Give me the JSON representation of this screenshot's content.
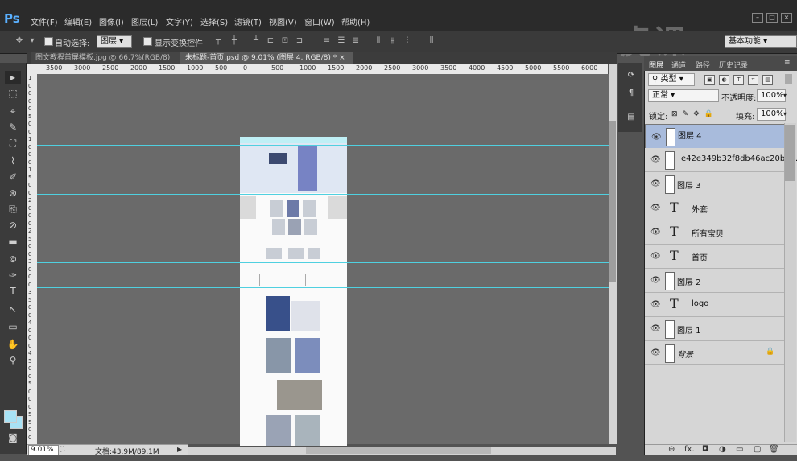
{
  "app": {
    "logo": "Ps"
  },
  "menu": [
    "文件(F)",
    "编辑(E)",
    "图像(I)",
    "图层(L)",
    "文字(Y)",
    "选择(S)",
    "滤镜(T)",
    "视图(V)",
    "窗口(W)",
    "帮助(H)"
  ],
  "watermark": "虎课",
  "options": {
    "auto_select_label": "自动选择:",
    "auto_select_value": "图层",
    "show_transform_label": "显示变换控件",
    "workspace": "基本功能"
  },
  "tabs": [
    {
      "label": "图文教程首屏模板.jpg @ 66.7%(RGB/8)",
      "close": "×"
    },
    {
      "label": "未标题-首页.psd @ 9.01% (图层 4, RGB/8) *",
      "close": "×"
    }
  ],
  "ruler_h": [
    "3500",
    "3000",
    "2500",
    "2000",
    "1500",
    "1000",
    "500",
    "0",
    "500",
    "1000",
    "1500",
    "2000",
    "2500",
    "3000",
    "3500",
    "4000",
    "4500",
    "5000",
    "5500",
    "6000",
    "6500"
  ],
  "ruler_v": [
    "1",
    "0",
    "0",
    "0",
    "0",
    "5",
    "0",
    "0",
    "1",
    "0",
    "0",
    "0",
    "1",
    "5",
    "0",
    "0",
    "2",
    "0",
    "0",
    "0",
    "2",
    "5",
    "0",
    "0",
    "3",
    "0",
    "0",
    "0",
    "3",
    "5",
    "0",
    "0",
    "4",
    "0",
    "0",
    "0",
    "4",
    "5",
    "0",
    "0",
    "5",
    "0",
    "0",
    "0",
    "5",
    "5",
    "0",
    "0"
  ],
  "status": {
    "zoom": "9.01%",
    "doc": "文档:43.9M/89.1M"
  },
  "panel": {
    "tabs": [
      "图层",
      "通道",
      "路径",
      "历史记录"
    ],
    "filter_kind": "类型",
    "blend_mode": "正常",
    "opacity_label": "不透明度:",
    "opacity_value": "100%",
    "lock_label": "锁定:",
    "fill_label": "填充:",
    "fill_value": "100%"
  },
  "layers": [
    {
      "name": "图层 4",
      "type": "raster",
      "selected": true
    },
    {
      "name": "e42e349b32f8db46ac20b5d...",
      "type": "smart",
      "selected": false
    },
    {
      "name": "图层 3",
      "type": "raster",
      "selected": false
    },
    {
      "name": "外套",
      "type": "text",
      "selected": false
    },
    {
      "name": "所有宝贝",
      "type": "text",
      "selected": false
    },
    {
      "name": "首页",
      "type": "text",
      "selected": false
    },
    {
      "name": "图层 2",
      "type": "raster",
      "selected": false
    },
    {
      "name": "logo",
      "type": "text",
      "selected": false
    },
    {
      "name": "图层 1",
      "type": "raster",
      "selected": false
    },
    {
      "name": "背景",
      "type": "background",
      "selected": false
    }
  ],
  "colors": {
    "guide": "#4fd0e0",
    "selected_layer": "#a8bbdc",
    "foreground": "#a8e2f5",
    "background": "#a8e2f5"
  }
}
